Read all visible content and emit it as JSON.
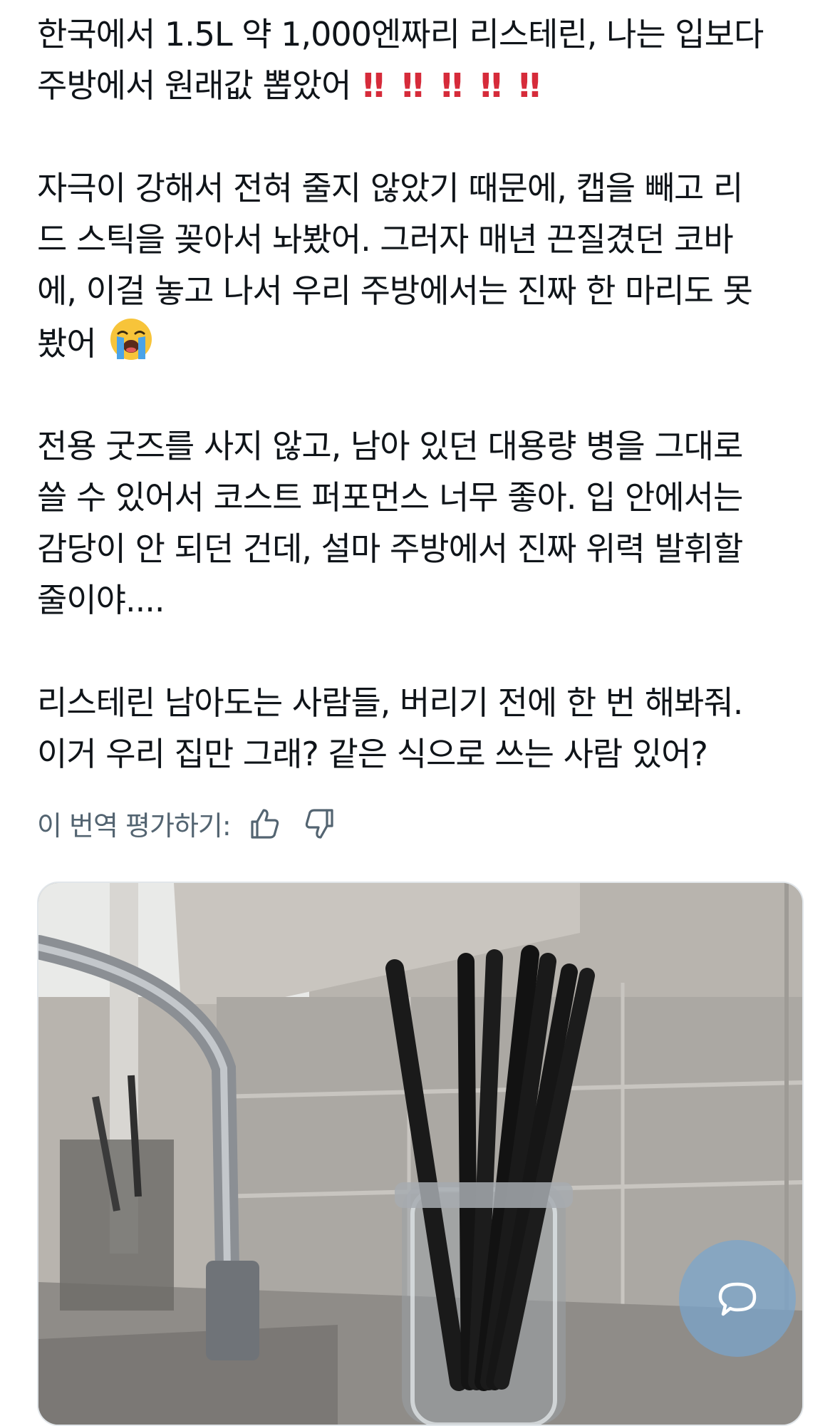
{
  "post": {
    "paragraphs": [
      {
        "lines": [
          "한국에서 1.5L 약 1,000엔짜리 리스테린, 나는 입보다",
          "주방에서 원래값 뽑았어"
        ],
        "trailing_emoji": "‼️‼️‼️‼️‼️",
        "bang_glyphs": [
          "‼",
          "‼",
          "‼",
          "‼",
          "‼"
        ]
      },
      {
        "lines": [
          "자극이 강해서 전혀 줄지 않았기 때문에, 캡을 빼고 리",
          "드 스틱을 꽂아서 놔봤어. 그러자 매년 끈질겼던 코바",
          "에, 이걸 놓고 나서 우리 주방에서는 진짜 한 마리도 못",
          "봤어"
        ],
        "trailing_emoji": "😭"
      },
      {
        "lines": [
          "전용 굿즈를 사지 않고, 남아 있던 대용량 병을 그대로",
          "쓸 수 있어서 코스트 퍼포먼스 너무 좋아. 입 안에서는",
          "감당이 안 되던 건데, 설마 주방에서 진짜 위력 발휘할",
          "줄이야...."
        ]
      },
      {
        "lines": [
          "리스테린 남아도는 사람들, 버리기 전에 한 번 해봐줘.",
          "이거 우리 집만 그래? 같은 식으로 쓰는 사람 있어?"
        ]
      }
    ]
  },
  "translation_rating": {
    "label": "이 번역 평가하기:",
    "thumbs_up_icon": "thumbs-up-icon",
    "thumbs_down_icon": "thumbs-down-icon"
  },
  "media": {
    "icon": "photo-of-reed-sticks-in-glass-bottle-by-kitchen-sink"
  },
  "floating_button": {
    "icon": "chat-bubble-icon"
  },
  "colors": {
    "text": "#0f1419",
    "secondary_text": "#536471",
    "emphasis_red": "#d62b3a",
    "card_border": "#e1e6ea",
    "fab_blue": "#78a5cd"
  }
}
